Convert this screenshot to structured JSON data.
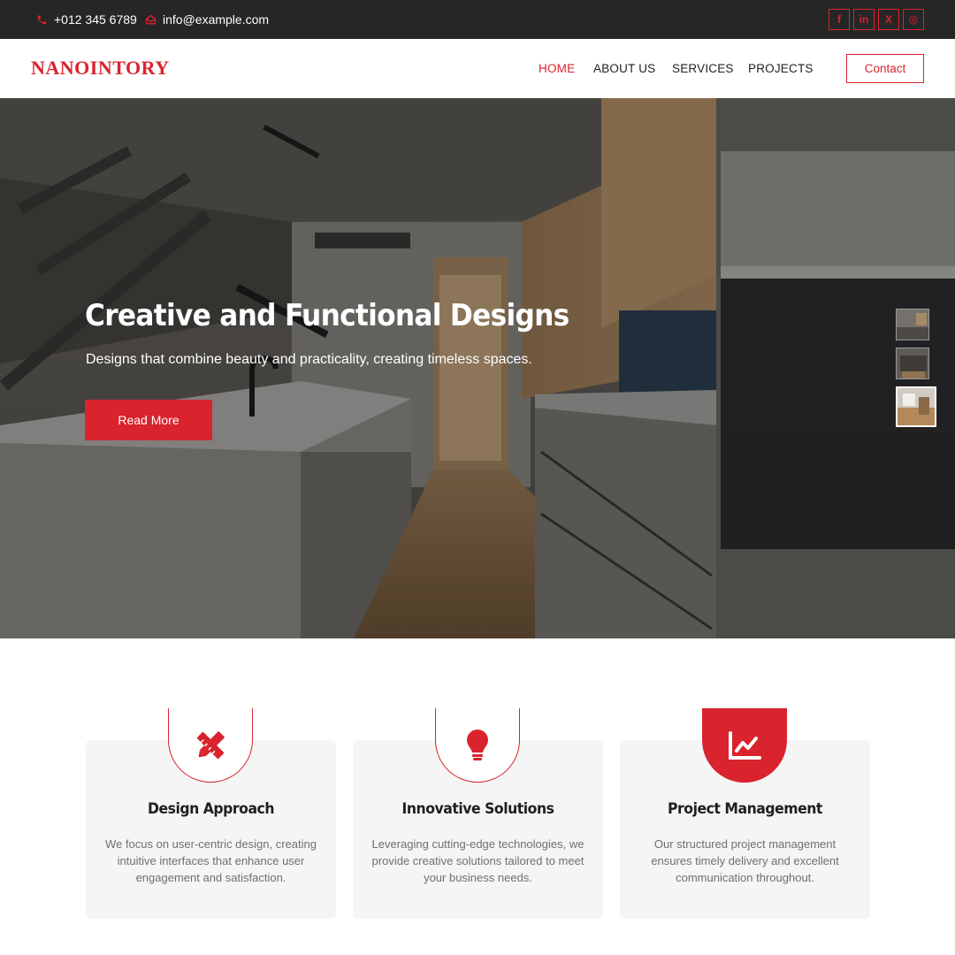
{
  "topbar": {
    "phone": "+012 345 6789",
    "email": "info@example.com",
    "socials": [
      {
        "icon": "facebook-icon",
        "glyph": "f"
      },
      {
        "icon": "linkedin-icon",
        "glyph": "in"
      },
      {
        "icon": "x-icon",
        "glyph": "X"
      },
      {
        "icon": "instagram-icon",
        "glyph": "◎"
      }
    ]
  },
  "nav": {
    "logo": "NANOINTORY",
    "links": [
      "HOME",
      "ABOUT US",
      "SERVICES",
      "PROJECTS"
    ],
    "active": "HOME",
    "contact": "Contact"
  },
  "hero": {
    "title": "Creative and Functional Designs",
    "subtitle": "Designs that combine beauty and practicality, creating timeless spaces.",
    "button": "Read More"
  },
  "features": [
    {
      "icon": "pencil-ruler-icon",
      "title": "Design Approach",
      "text": "We focus on user-centric design, creating intuitive interfaces that enhance user engagement and satisfaction."
    },
    {
      "icon": "lightbulb-icon",
      "title": "Innovative Solutions",
      "text": "Leveraging cutting-edge technologies, we provide creative solutions tailored to meet your business needs."
    },
    {
      "icon": "chart-line-icon",
      "title": "Project Management",
      "text": "Our structured project management ensures timely delivery and excellent communication throughout."
    }
  ],
  "colors": {
    "accent": "#d9232d",
    "topbar": "#262626",
    "card_bg": "#f5f5f5"
  }
}
